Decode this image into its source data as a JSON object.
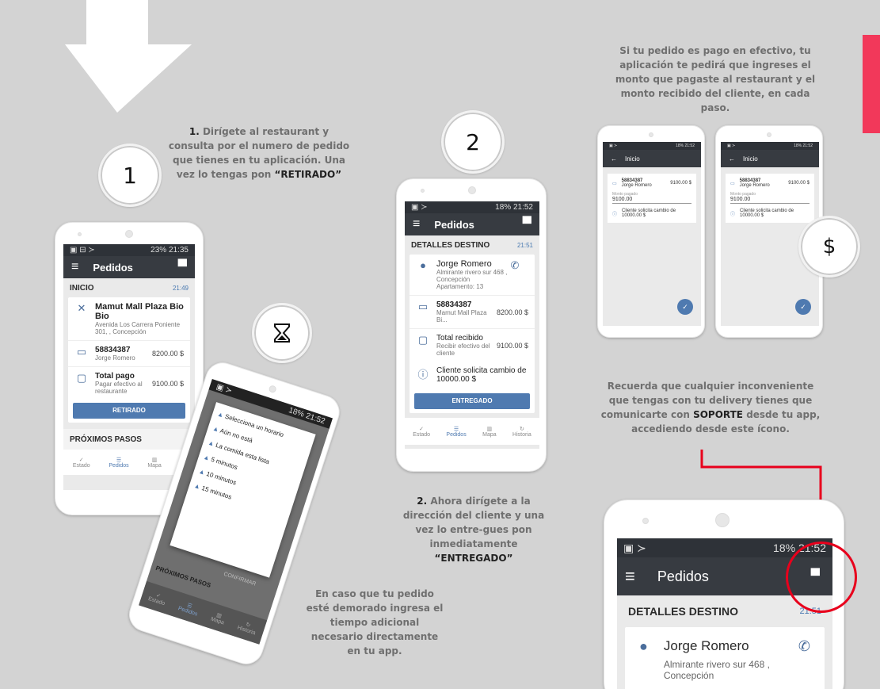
{
  "step1": {
    "number": "1",
    "prefix": "1.",
    "text": "Dirígete al restaurant y consulta por el numero de pedido que tienes en tu aplicación. Una vez lo tengas pon",
    "highlight": "“RETIRADO”"
  },
  "step2": {
    "number": "2",
    "prefix": "2.",
    "text": "Ahora dirígete a la dirección del cliente y una vez lo entre-gues pon inmediatamente",
    "highlight": "“ENTREGADO”"
  },
  "delay_note": "En caso que tu pedido esté demorado ingresa el tiempo adicional necesario directamente en tu app.",
  "cash_note": "Si tu pedido es pago en efectivo, tu aplicación te pedirá que ingreses el monto que pagaste al restaurant y el monto recibido del cliente, en cada paso.",
  "support_note": {
    "before": "Recuerda que cualquier inconveniente que tengas con tu delivery tienes que comunicarte con",
    "highlight": "SOPORTE",
    "after": "desde tu app, accediendo desde este ícono."
  },
  "dollar": "$",
  "phone1": {
    "status_right": "23% 21:35",
    "title": "Pedidos",
    "section": "INICIO",
    "section_time": "21:49",
    "restaurant": "Mamut Mall Plaza Bio Bio",
    "restaurant_addr": "Avenida Los Carrera Poniente 301, , Concepción",
    "order_id": "58834387",
    "order_client": "Jorge Romero",
    "order_amount": "8200.00 $",
    "pay_title": "Total pago",
    "pay_sub": "Pagar efectivo al restaurante",
    "pay_amount": "9100.00 $",
    "button": "RETIRADO",
    "next": "PRÓXIMOS PASOS",
    "nav": [
      "Estado",
      "Pedidos",
      "Mapa",
      "Hi"
    ]
  },
  "phone2": {
    "status_right": "18% 21:52",
    "title": "Pedidos",
    "section": "DETALLES DESTINO",
    "section_time": "21:51",
    "client": "Jorge Romero",
    "client_addr": "Almirante rivero sur 468 , Concepción",
    "client_apt": "Apartamento: 13",
    "order_id": "58834387",
    "order_rest": "Mamut Mall Plaza Bi...",
    "order_amount": "8200.00 $",
    "recv_title": "Total recibido",
    "recv_sub": "Recibir efectivo del cliente",
    "recv_amount": "9100.00 $",
    "change": "Cliente solicita cambio de 10000.00 $",
    "button": "ENTREGADO",
    "nav": [
      "Estado",
      "Pedidos",
      "Mapa",
      "Historia"
    ]
  },
  "phone3": {
    "status_right": "18% 21:52",
    "options": [
      "Selecciona un horario",
      "Aún no está",
      "La comida esta lista",
      "5 minutos",
      "10 minutos",
      "15 minutos"
    ],
    "confirm": "CONFIRMAR",
    "next": "PRÓXIMOS PASOS",
    "nav": [
      "Estado",
      "Pedidos",
      "Mapa",
      "Historia"
    ]
  },
  "mini": {
    "status_right": "18% 21:52",
    "title": "Inicio",
    "order_id": "58834387",
    "client": "Jorge Romero",
    "amount": "9100.00 $",
    "field_label": "Monto pagado",
    "field_value": "9100.00",
    "change": "Cliente solicita cambio de 10000.00 $"
  },
  "phone4": {
    "status_right": "18% 21:52",
    "title": "Pedidos",
    "section": "DETALLES DESTINO",
    "section_time": "21:51",
    "client": "Jorge Romero",
    "client_addr": "Almirante rivero sur 468 , Concepción"
  },
  "colors": {
    "accent": "#4f7ab0",
    "highlight_red": "#e8001c",
    "brand_bar": "#f2385a",
    "appbar": "#373b41"
  }
}
